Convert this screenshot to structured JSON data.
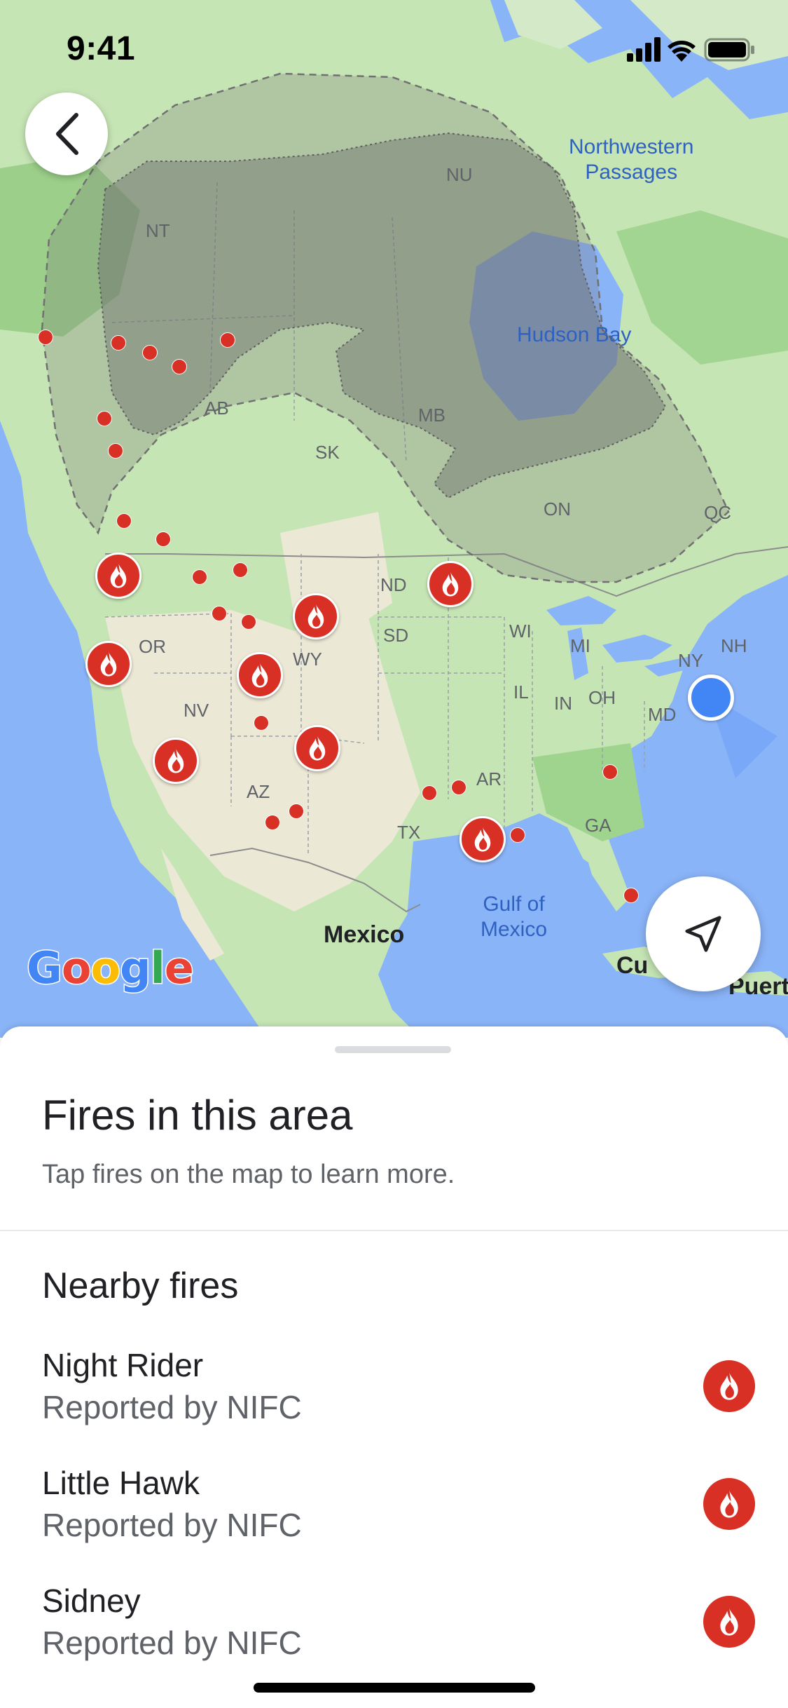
{
  "status_bar": {
    "time": "9:41"
  },
  "map": {
    "labels": {
      "nu": "NU",
      "nt": "NT",
      "ab": "AB",
      "mb": "MB",
      "sk": "SK",
      "on": "ON",
      "qc": "QC",
      "nd": "ND",
      "sd": "SD",
      "wy": "WY",
      "or": "OR",
      "nv": "NV",
      "az": "AZ",
      "tx": "TX",
      "ar": "AR",
      "ga": "GA",
      "wi": "WI",
      "mi": "MI",
      "il": "IL",
      "in": "IN",
      "oh": "OH",
      "ny": "NY",
      "nh": "NH",
      "md": "MD"
    },
    "water": {
      "northwestern_passages": "Northwestern\nPassages",
      "hudson_bay": "Hudson Bay",
      "gulf_of_mexico": "Gulf of\nMexico"
    },
    "cities": {
      "mexico": "Mexico",
      "cuba": "Cu",
      "puerto": "Puert"
    },
    "attribution": "Google",
    "fire_color": "#d93025",
    "user_location_color": "#4285f4",
    "water_color": "#8ab4f8",
    "land_color": "#c6e5b5"
  },
  "buttons": {
    "back_icon": "chevron-left-icon",
    "locate_icon": "navigation-arrow-icon"
  },
  "sheet": {
    "title": "Fires in this area",
    "subtitle": "Tap fires on the map to learn more.",
    "section_title": "Nearby fires",
    "fires": [
      {
        "name": "Night Rider",
        "source": "Reported by NIFC"
      },
      {
        "name": "Little Hawk",
        "source": "Reported by NIFC"
      },
      {
        "name": "Sidney",
        "source": "Reported by NIFC"
      }
    ]
  }
}
